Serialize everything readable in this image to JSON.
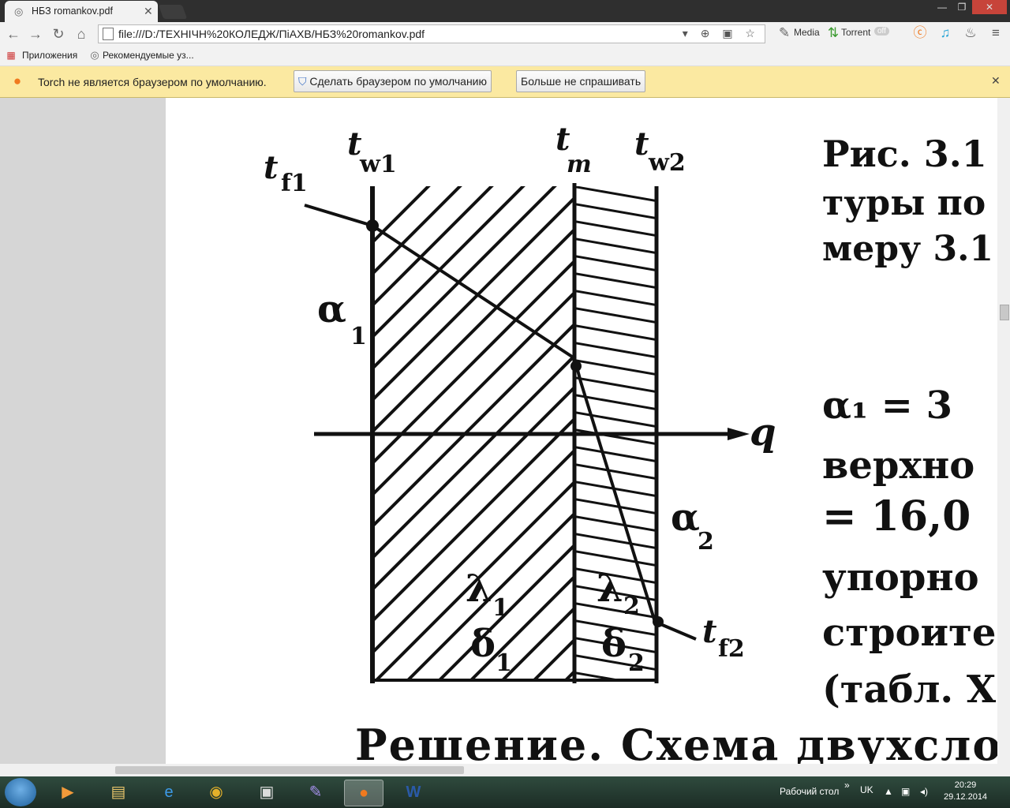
{
  "browser": {
    "tab": {
      "title": "НБЗ romankov.pdf",
      "close": "✕"
    },
    "window_controls": {
      "minimize": "—",
      "restore": "❐",
      "close": "✕"
    },
    "url": "file:///D:/ТЕХНІЧН%20КОЛЕДЖ/ПіАХВ/НБЗ%20romankov.pdf",
    "extensions": {
      "media": "Media",
      "torrent": "Torrent",
      "toggle": "off"
    },
    "bookmarks": {
      "apps": "Приложения",
      "recommended": "Рекомендуемые уз..."
    },
    "infobar": {
      "message": "Torch не является браузером по умолчанию.",
      "make_default": "Сделать браузером по умолчанию",
      "dont_ask": "Больше не спрашивать",
      "close": "✕"
    }
  },
  "document": {
    "figure": {
      "labels": {
        "t_f1": "t",
        "t_f1_sub": "f1",
        "t_w1": "t",
        "t_w1_sub": "w1",
        "t_m": "t",
        "t_m_sub": "m",
        "t_w2": "t",
        "t_w2_sub": "w2",
        "t_f2": "t",
        "t_f2_sub": "f2",
        "alpha1": "α",
        "alpha1_sub": "1",
        "alpha2": "α",
        "alpha2_sub": "2",
        "lambda1": "λ",
        "lambda1_sub": "1",
        "lambda2": "λ",
        "lambda2_sub": "2",
        "delta1": "δ",
        "delta1_sub": "1",
        "delta2": "δ",
        "delta2_sub": "2",
        "q": "q"
      }
    },
    "right_text": [
      "Рис. 3.1",
      "туры по",
      "меру 3.1",
      "α₁ = 3",
      "верхно",
      "= 16,0",
      "упорно",
      "строите",
      "(табл. Х"
    ],
    "bottom_text": "Решение. Схема двухсло"
  },
  "taskbar": {
    "desktop": "Рабочий стол",
    "lang": "UK",
    "time": "20:29",
    "date": "29.12.2014"
  }
}
